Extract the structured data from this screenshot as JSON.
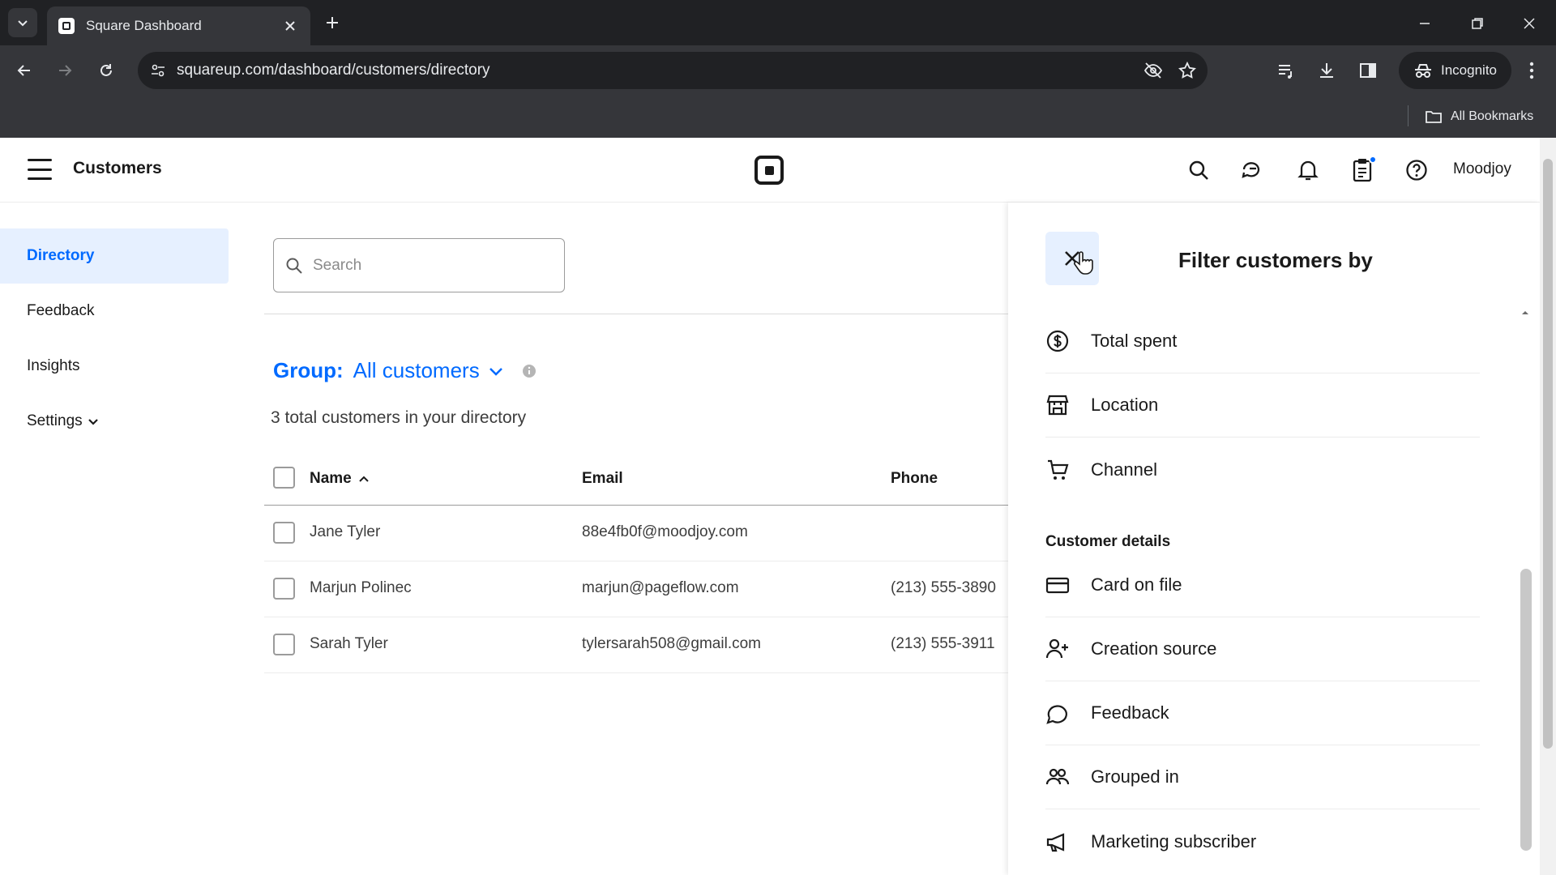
{
  "browser": {
    "tab_title": "Square Dashboard",
    "url": "squareup.com/dashboard/customers/directory",
    "incognito_label": "Incognito",
    "bookmarks_label": "All Bookmarks"
  },
  "header": {
    "title": "Customers",
    "user": "Moodjoy"
  },
  "sidebar": {
    "items": [
      {
        "label": "Directory",
        "active": true
      },
      {
        "label": "Feedback"
      },
      {
        "label": "Insights"
      },
      {
        "label": "Settings"
      }
    ]
  },
  "main": {
    "search_placeholder": "Search",
    "group_label": "Group:",
    "group_value": "All customers",
    "total_text": "3 total customers in your directory",
    "columns": [
      "Name",
      "Email",
      "Phone"
    ],
    "rows": [
      {
        "name": "Jane Tyler",
        "email": "88e4fb0f@moodjoy.com",
        "phone": ""
      },
      {
        "name": "Marjun Polinec",
        "email": "marjun@pageflow.com",
        "phone": "(213) 555-3890"
      },
      {
        "name": "Sarah Tyler",
        "email": "tylersarah508@gmail.com",
        "phone": "(213) 555-3911"
      }
    ]
  },
  "filter": {
    "title": "Filter customers by",
    "items": [
      {
        "label": "Total spent",
        "icon": "dollar-circle-icon"
      },
      {
        "label": "Location",
        "icon": "store-icon"
      },
      {
        "label": "Channel",
        "icon": "cart-icon"
      }
    ],
    "section_label": "Customer details",
    "details": [
      {
        "label": "Card on file",
        "icon": "credit-card-icon"
      },
      {
        "label": "Creation source",
        "icon": "person-add-icon"
      },
      {
        "label": "Feedback",
        "icon": "chat-bubble-icon"
      },
      {
        "label": "Grouped in",
        "icon": "people-icon"
      },
      {
        "label": "Marketing subscriber",
        "icon": "megaphone-icon"
      }
    ]
  },
  "colors": {
    "accent": "#006aff",
    "active_bg": "#e6f0ff"
  }
}
